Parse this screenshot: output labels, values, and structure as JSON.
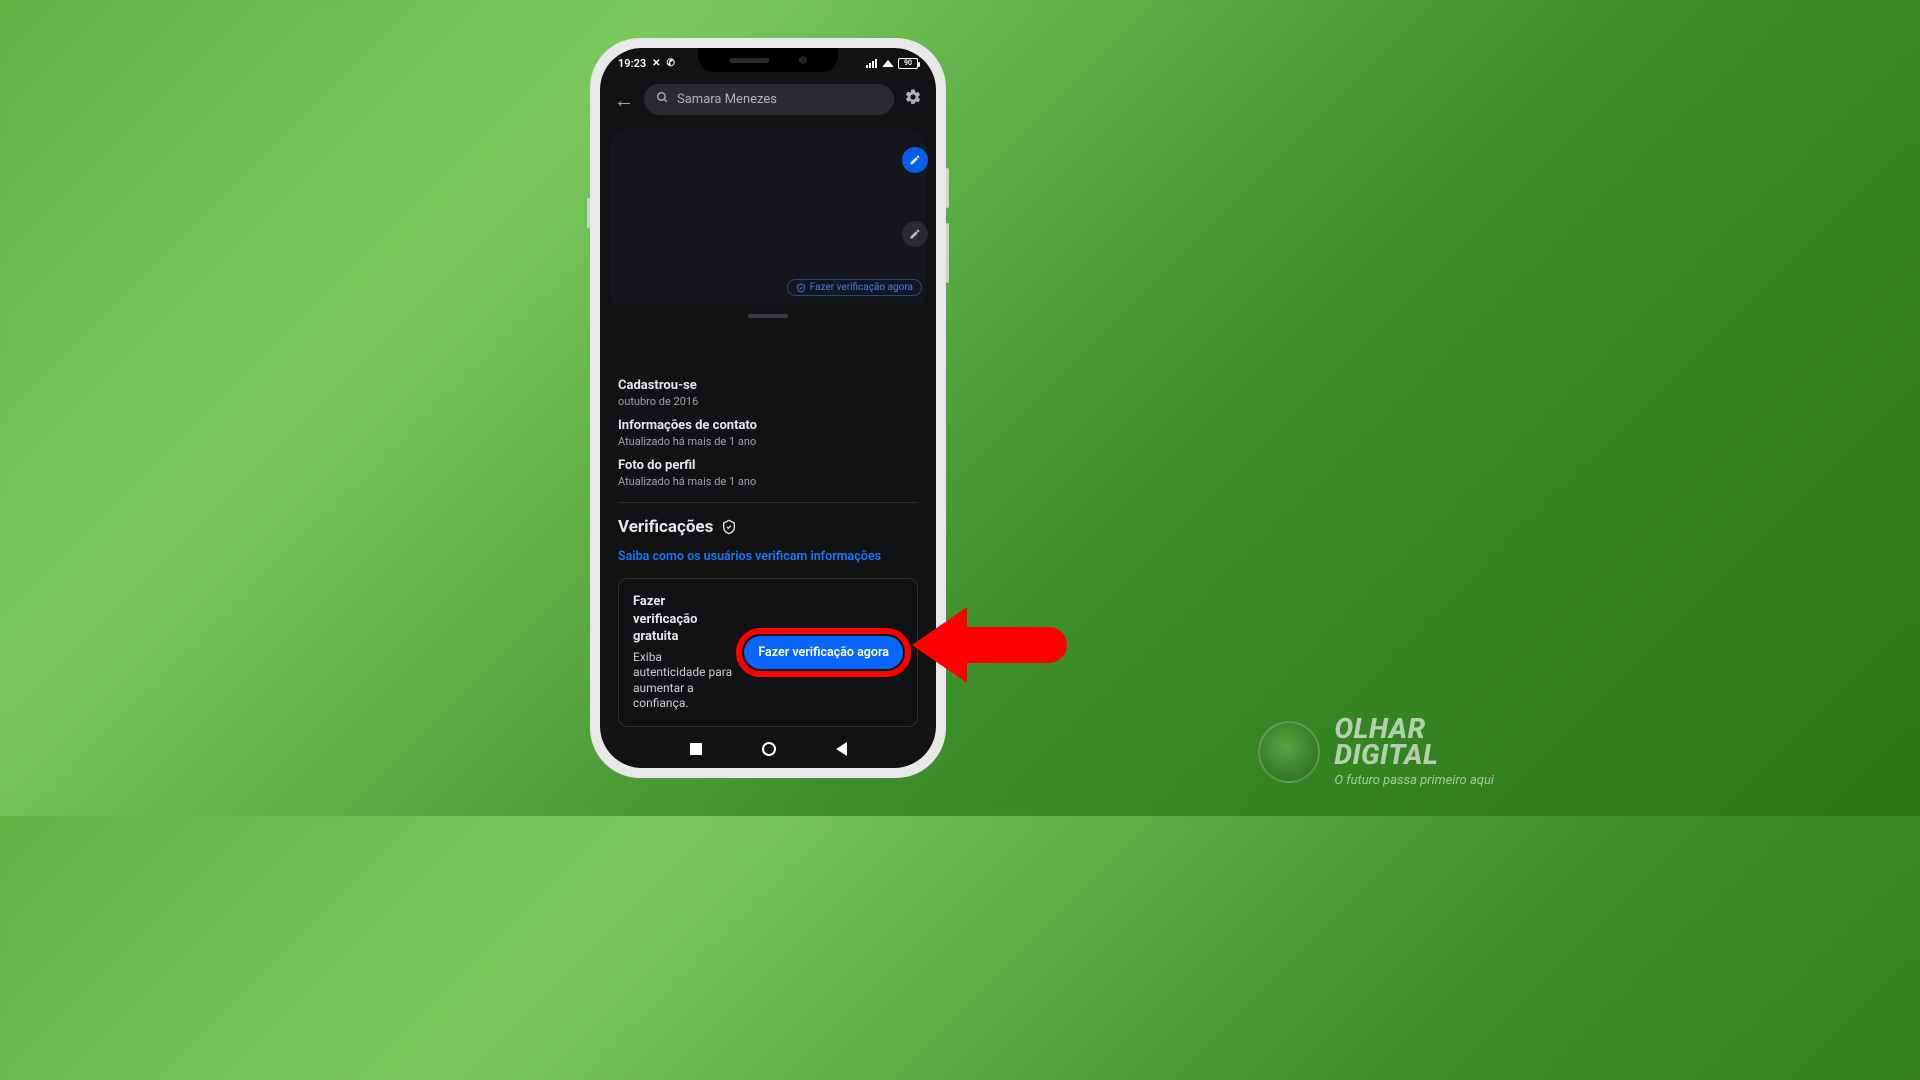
{
  "status": {
    "time": "19:23",
    "battery": "90"
  },
  "search": {
    "name": "Samara Menezes"
  },
  "ghost_pill": {
    "label": "Fazer verificação agora"
  },
  "info": {
    "joined_title": "Cadastrou-se",
    "joined_sub": "outubro de 2016",
    "contact_title": "Informações de contato",
    "contact_sub": "Atualizado há mais de 1 ano",
    "photo_title": "Foto do perfil",
    "photo_sub": "Atualizado há mais de 1 ano"
  },
  "verifications": {
    "header": "Verificações",
    "learn_link": "Saiba como os usuários verificam informações",
    "card_title": "Fazer verificação gratuita",
    "card_sub": "Exiba autenticidade para aumentar a confiança.",
    "cta": "Fazer verificação agora"
  },
  "watermark": {
    "line1": "OLHAR",
    "line2": "DIGITAL",
    "tagline": "O futuro passa primeiro aqui"
  }
}
